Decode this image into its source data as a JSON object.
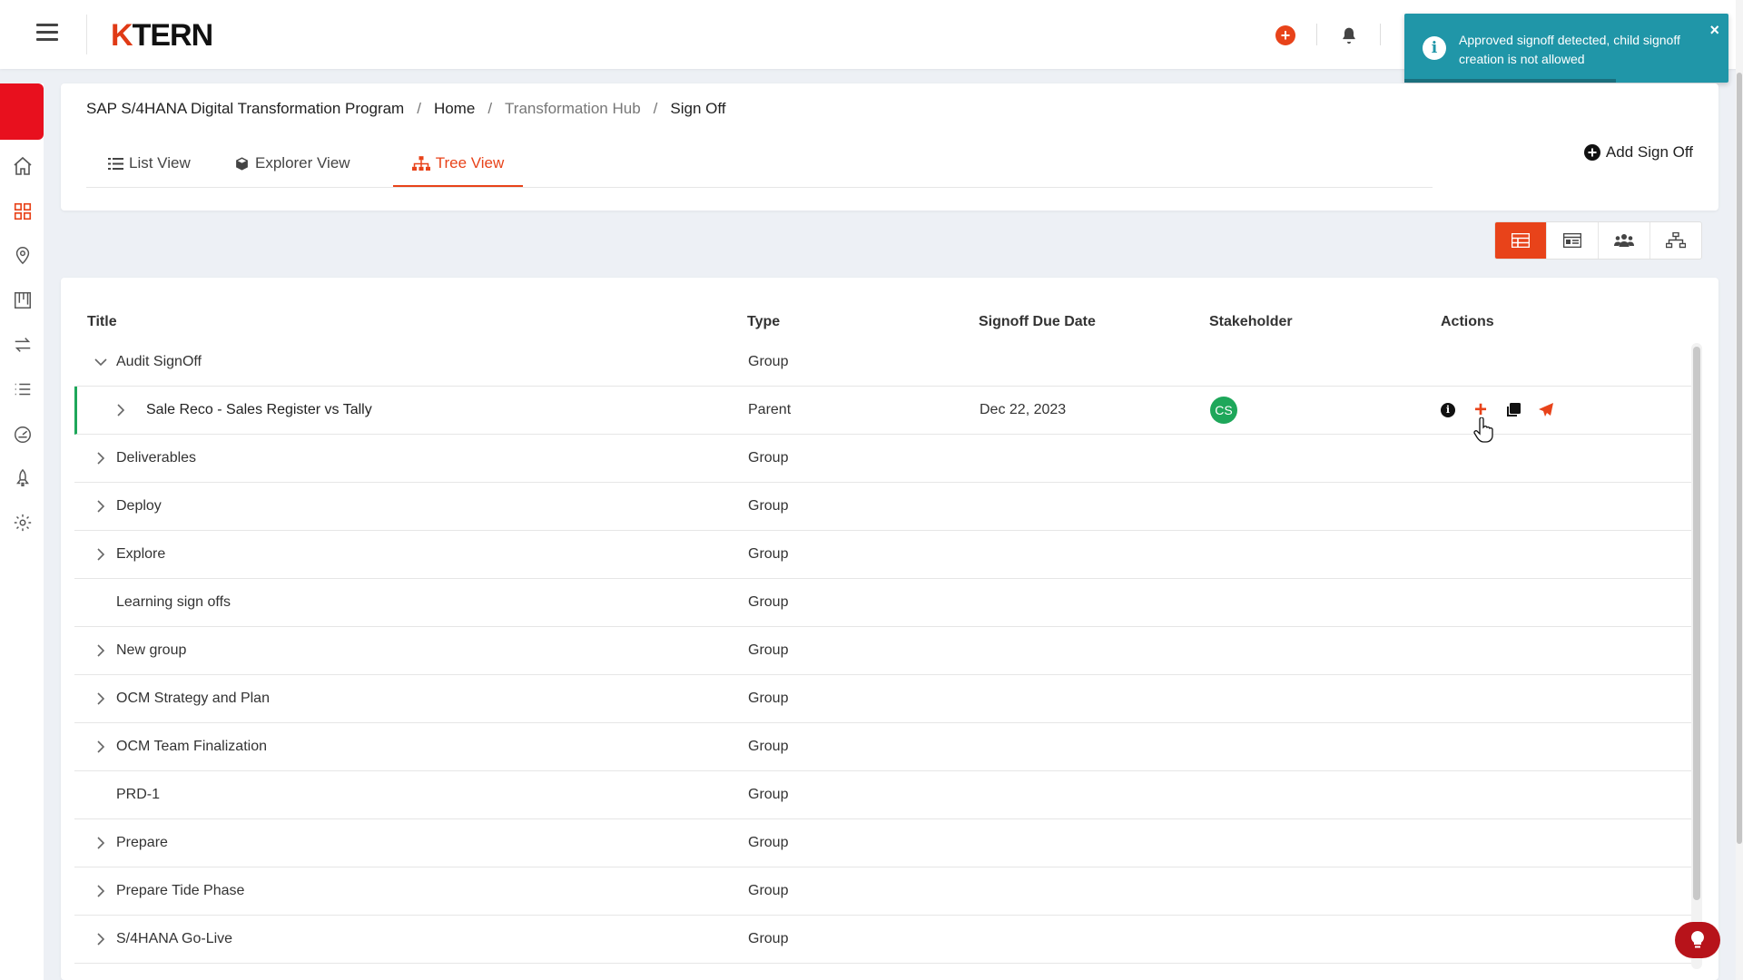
{
  "app": {
    "logo_k": "K",
    "logo_rest": "TERN"
  },
  "toast": {
    "message": "Approved signoff detected, child signoff creation is not allowed",
    "close": "×",
    "icon": "i"
  },
  "breadcrumb": {
    "program": "SAP S/4HANA Digital Transformation Program",
    "home": "Home",
    "hub": "Transformation Hub",
    "current": "Sign Off",
    "separator": "/"
  },
  "tabs": [
    {
      "label": "List View",
      "icon": "list-icon"
    },
    {
      "label": "Explorer View",
      "icon": "box-icon"
    },
    {
      "label": "Tree View",
      "icon": "sitemap-icon",
      "active": true
    }
  ],
  "add_signoff": {
    "label": "Add Sign Off",
    "icon": "plus-circle-icon"
  },
  "view_buttons": [
    "table-view-icon",
    "card-view-icon",
    "users-view-icon",
    "hierarchy-view-icon"
  ],
  "table": {
    "headers": {
      "title": "Title",
      "type": "Type",
      "due": "Signoff Due Date",
      "stakeholder": "Stakeholder",
      "actions": "Actions"
    },
    "rows": [
      {
        "title": "Audit SignOff",
        "type": "Group",
        "expanded": true,
        "level": 0,
        "chevron": true
      },
      {
        "title": "Sale Reco - Sales Register vs Tally",
        "type": "Parent",
        "due": "Dec 22, 2023",
        "stakeholder": "CS",
        "level": 1,
        "chevron": true,
        "selected": true
      },
      {
        "title": "Deliverables",
        "type": "Group",
        "level": 0,
        "chevron": true
      },
      {
        "title": "Deploy",
        "type": "Group",
        "level": 0,
        "chevron": true
      },
      {
        "title": "Explore",
        "type": "Group",
        "level": 0,
        "chevron": true
      },
      {
        "title": "Learning sign offs",
        "type": "Group",
        "level": 0,
        "chevron": false
      },
      {
        "title": "New group",
        "type": "Group",
        "level": 0,
        "chevron": true
      },
      {
        "title": "OCM Strategy and Plan",
        "type": "Group",
        "level": 0,
        "chevron": true
      },
      {
        "title": "OCM Team Finalization",
        "type": "Group",
        "level": 0,
        "chevron": true
      },
      {
        "title": "PRD-1",
        "type": "Group",
        "level": 0,
        "chevron": false
      },
      {
        "title": "Prepare",
        "type": "Group",
        "level": 0,
        "chevron": true
      },
      {
        "title": "Prepare Tide Phase",
        "type": "Group",
        "level": 0,
        "chevron": true
      },
      {
        "title": "S/4HANA Go-Live",
        "type": "Group",
        "level": 0,
        "chevron": true
      }
    ]
  },
  "colors": {
    "accent": "#e8431a",
    "toast": "#2096a8",
    "success": "#1ea75a",
    "sidebar_accent": "#e8101e"
  }
}
